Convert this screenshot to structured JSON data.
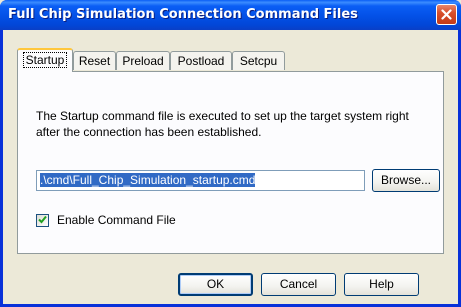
{
  "window": {
    "title": "Full Chip Simulation Connection Command Files"
  },
  "tabs": [
    {
      "label": "Startup",
      "active": true
    },
    {
      "label": "Reset",
      "active": false
    },
    {
      "label": "Preload",
      "active": false
    },
    {
      "label": "Postload",
      "active": false
    },
    {
      "label": "Setcpu",
      "active": false
    }
  ],
  "panel": {
    "description": "The Startup command file is executed to set up the target system right after the connection has been established.",
    "file_path": ".\\cmd\\Full_Chip_Simulation_startup.cmd",
    "browse_label": "Browse...",
    "enable_label": "Enable Command File",
    "enable_checked": true
  },
  "footer": {
    "ok_label": "OK",
    "cancel_label": "Cancel",
    "help_label": "Help"
  },
  "colors": {
    "titlebar": "#0350e6",
    "selection": "#316ac5",
    "active_tab_accent": "#ffc73c",
    "close_button": "#d8502c"
  },
  "icons": {
    "close": "close-icon",
    "check": "checkmark-icon"
  }
}
